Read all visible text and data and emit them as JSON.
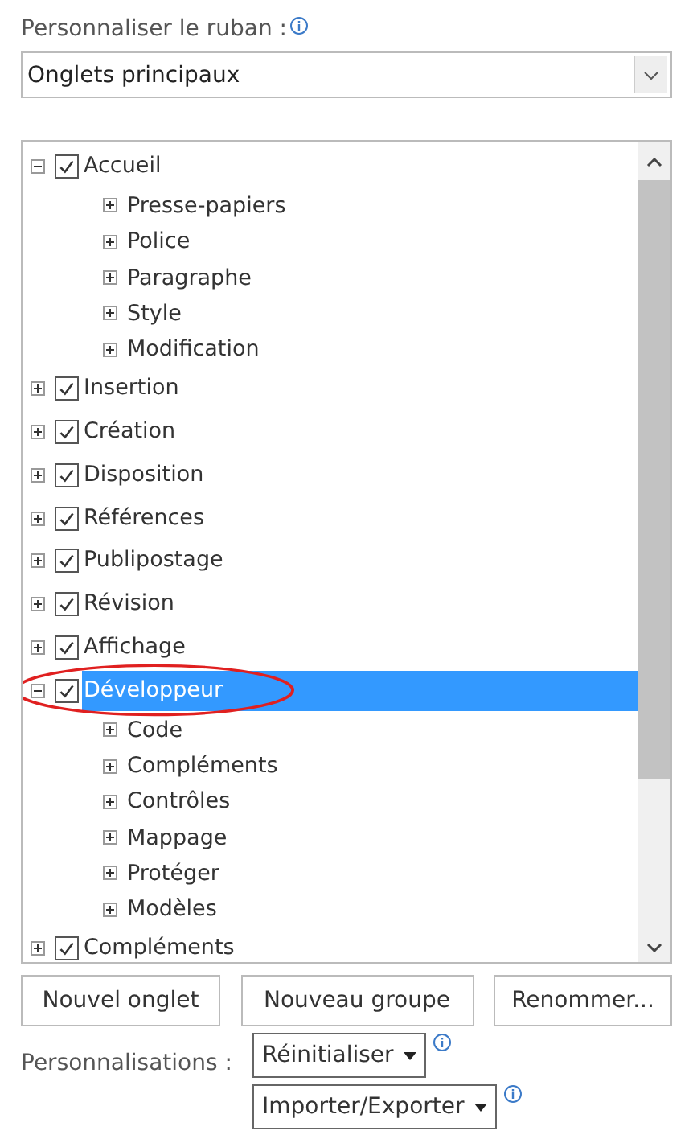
{
  "ribbon_label": "Personnaliser le ruban :",
  "ribbon_select": {
    "value": "Onglets principaux"
  },
  "tabs_tree": [
    {
      "label": "Accueil",
      "checked": true,
      "expanded": true,
      "selected": false,
      "children": [
        {
          "label": "Presse-papiers",
          "expanded": false
        },
        {
          "label": "Police",
          "expanded": false
        },
        {
          "label": "Paragraphe",
          "expanded": false
        },
        {
          "label": "Style",
          "expanded": false
        },
        {
          "label": "Modification",
          "expanded": false
        }
      ]
    },
    {
      "label": "Insertion",
      "checked": true,
      "expanded": false,
      "selected": false
    },
    {
      "label": "Création",
      "checked": true,
      "expanded": false,
      "selected": false
    },
    {
      "label": "Disposition",
      "checked": true,
      "expanded": false,
      "selected": false
    },
    {
      "label": "Références",
      "checked": true,
      "expanded": false,
      "selected": false
    },
    {
      "label": "Publipostage",
      "checked": true,
      "expanded": false,
      "selected": false
    },
    {
      "label": "Révision",
      "checked": true,
      "expanded": false,
      "selected": false
    },
    {
      "label": "Affichage",
      "checked": true,
      "expanded": false,
      "selected": false
    },
    {
      "label": "Développeur",
      "checked": true,
      "expanded": true,
      "selected": true,
      "circled": true,
      "children": [
        {
          "label": "Code",
          "expanded": false
        },
        {
          "label": "Compléments",
          "expanded": false
        },
        {
          "label": "Contrôles",
          "expanded": false
        },
        {
          "label": "Mappage",
          "expanded": false
        },
        {
          "label": "Protéger",
          "expanded": false
        },
        {
          "label": "Modèles",
          "expanded": false
        }
      ]
    },
    {
      "label": "Compléments",
      "checked": true,
      "expanded": false,
      "selected": false
    }
  ],
  "buttons": [
    "Nouvel onglet",
    "Nouveau groupe",
    "Renommer..."
  ],
  "customizations_label": "Personnalisations :",
  "customization_menus": [
    "Réinitialiser",
    "Importer/Exporter"
  ]
}
